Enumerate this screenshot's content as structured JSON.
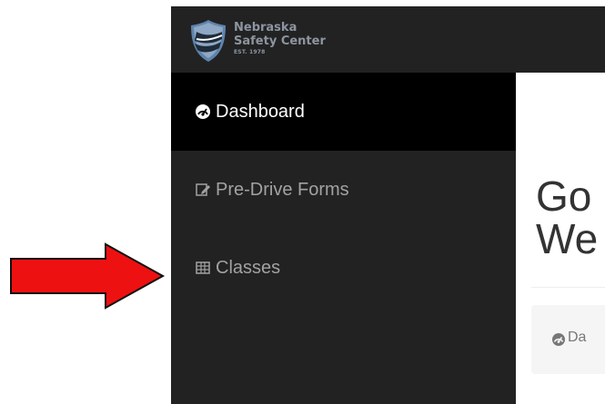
{
  "brand": {
    "line1": "Nebraska",
    "line2": "Safety Center",
    "line3": "EST. 1978",
    "logo_icon": "shield-road-icon",
    "colors": {
      "background": "#222222",
      "text": "#8d95a0",
      "shield": "#5f84ad",
      "road": "#1f2b38"
    }
  },
  "sidebar": {
    "items": [
      {
        "label": "Dashboard",
        "icon": "dashboard-gauge-icon",
        "active": true
      },
      {
        "label": "Pre-Drive Forms",
        "icon": "edit-form-icon",
        "active": false
      },
      {
        "label": "Classes",
        "icon": "table-grid-icon",
        "active": false
      }
    ],
    "colors": {
      "background": "#222222",
      "active_background": "#000000",
      "active_text": "#ffffff",
      "inactive_text": "#a2a2a2"
    }
  },
  "main": {
    "title": "Go\nWe",
    "breadcrumb": {
      "label": "Da",
      "icon": "dashboard-gauge-icon"
    },
    "colors": {
      "title": "#333333",
      "breadcrumb_background": "#f5f5f5",
      "breadcrumb_text": "#777777"
    }
  },
  "annotation": {
    "icon": "arrow-right-icon",
    "fill": "#ee1111",
    "stroke": "#111111"
  }
}
